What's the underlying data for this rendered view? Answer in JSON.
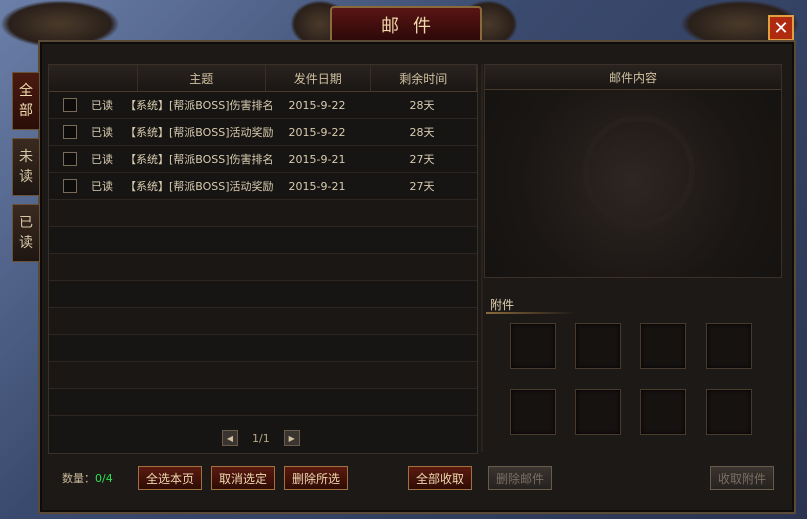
{
  "window": {
    "title": "邮件",
    "close_label": "✕"
  },
  "side_tabs": [
    {
      "label_top": "全",
      "label_bottom": "部",
      "active": true
    },
    {
      "label_top": "未",
      "label_bottom": "读",
      "active": false
    },
    {
      "label_top": "已",
      "label_bottom": "读",
      "active": false
    }
  ],
  "list": {
    "headers": [
      "主题",
      "发件日期",
      "剩余时间"
    ],
    "rows": [
      {
        "status": "已读",
        "subject": "【系统】[帮派BOSS]伤害排名",
        "date": "2015-9-22",
        "remaining": "28天"
      },
      {
        "status": "已读",
        "subject": "【系统】[帮派BOSS]活动奖励",
        "date": "2015-9-22",
        "remaining": "28天"
      },
      {
        "status": "已读",
        "subject": "【系统】[帮派BOSS]伤害排名",
        "date": "2015-9-21",
        "remaining": "27天"
      },
      {
        "status": "已读",
        "subject": "【系统】[帮派BOSS]活动奖励",
        "date": "2015-9-21",
        "remaining": "27天"
      }
    ]
  },
  "pager": {
    "text": "1/1",
    "prev": "◀",
    "next": "▶"
  },
  "content": {
    "header": "邮件内容"
  },
  "attachments": {
    "label": "附件"
  },
  "footer": {
    "count_label": "数量：",
    "count_value": "0/4",
    "buttons": {
      "select_page": "全选本页",
      "deselect": "取消选定",
      "delete_selected": "删除所选",
      "collect_all": "全部收取",
      "delete_mail": "删除邮件",
      "collect_attachment": "收取附件"
    }
  }
}
